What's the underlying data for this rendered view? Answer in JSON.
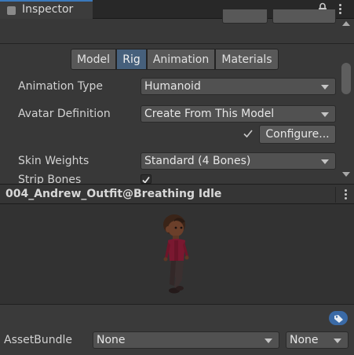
{
  "window": {
    "tab_title": "Inspector",
    "icons": {
      "tab": "inspector-icon",
      "lock": "lock-icon",
      "menu": "kebab-menu-icon"
    }
  },
  "rig_tabs": [
    {
      "label": "Model",
      "active": false
    },
    {
      "label": "Rig",
      "active": true
    },
    {
      "label": "Animation",
      "active": false
    },
    {
      "label": "Materials",
      "active": false
    }
  ],
  "fields": {
    "animation_type": {
      "label": "Animation Type",
      "value": "Humanoid"
    },
    "avatar_definition": {
      "label": "Avatar Definition",
      "value": "Create From This Model"
    },
    "configure_label": "Configure...",
    "skin_weights": {
      "label": "Skin Weights",
      "value": "Standard (4 Bones)"
    },
    "strip_bones": {
      "label": "Strip Bones",
      "checked": true
    }
  },
  "preview": {
    "title": "004_Andrew_Outfit@Breathing Idle"
  },
  "asset_bundle": {
    "label": "AssetBundle",
    "name_value": "None",
    "variant_value": "None"
  },
  "colors": {
    "accent": "#3a79bb",
    "active_tab": "#46607c",
    "panel": "#383838",
    "tag_badge": "#3a6aa6"
  }
}
